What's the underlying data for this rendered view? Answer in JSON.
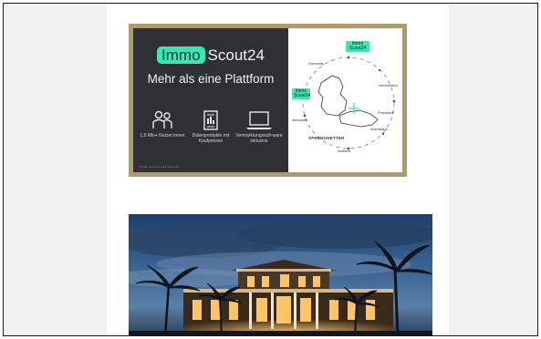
{
  "banner": {
    "brand_immo": "Immo",
    "brand_scout": "Scout24",
    "tagline": "Mehr als eine Plattform",
    "features": [
      {
        "icon": "users-icon",
        "label": "1,5 Mio+ Nutzer:innen"
      },
      {
        "icon": "data-products-icon",
        "label": "Datenprodukte mit Kaufpreisen"
      },
      {
        "icon": "laptop-icon",
        "label": "Vermarktungssoft-ware inklusive"
      }
    ],
    "fineprint": "*Quelle: ImmoScout24 Österreich",
    "network": {
      "top_badge": "Immo Scout24",
      "left_badge": "Immo Scout24",
      "homeday": "Homeday",
      "immounited": "immounited",
      "propstack": "Propstack",
      "sprengnetter": "SPRENGNETTER",
      "immowelt": "immowelt",
      "innenbank": "Innenbank",
      "realbest": "realbest"
    }
  },
  "colors": {
    "frame": "#b09a67",
    "panel": "#2e3034",
    "accent": "#3ce6b4"
  },
  "photo": {
    "alt_icon": "villa-photo"
  }
}
